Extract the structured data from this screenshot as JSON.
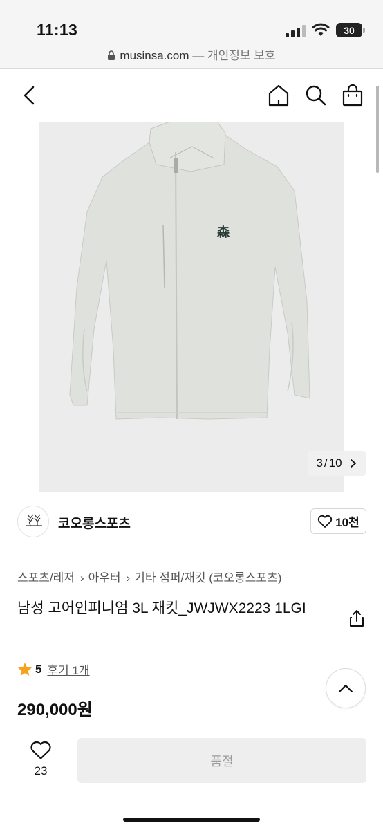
{
  "status_bar": {
    "time": "11:13",
    "battery": "30"
  },
  "browser": {
    "domain": "musinsa.com",
    "suffix": "— 개인정보 보호"
  },
  "gallery": {
    "current": "3",
    "total": "10",
    "separator": "/"
  },
  "brand": {
    "name": "코오롱스포츠",
    "like_count": "10천"
  },
  "breadcrumb": [
    "스포츠/레저",
    "아우터",
    "기타 점퍼/재킷 (코오롱스포츠)"
  ],
  "product": {
    "title": "남성 고어인피니엄 3L 재킷_JWJWX2223 1LGI",
    "rating": "5",
    "reviews": "후기 1개",
    "price": "290,000원"
  },
  "bottom_bar": {
    "like_count": "23",
    "buy_label": "품절"
  },
  "colors": {
    "rating_star": "#f6a21c",
    "soldout_bg": "#eeeeee",
    "soldout_text": "#9c9c9c",
    "jacket": "#dfe1dd"
  }
}
